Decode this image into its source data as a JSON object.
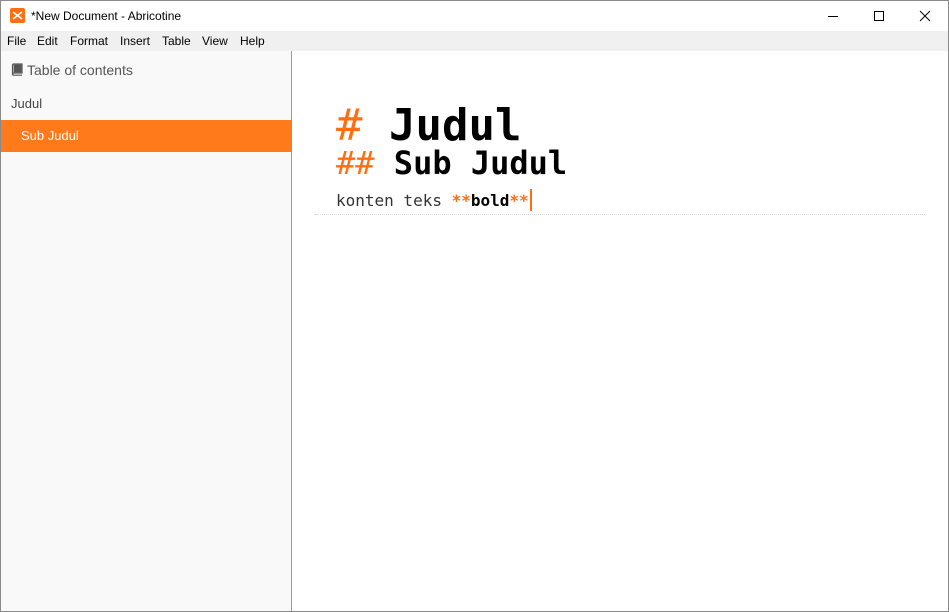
{
  "window": {
    "title": "*New Document - Abricotine",
    "icon": "abricotine-app-icon",
    "controls": [
      "minimize-icon",
      "maximize-icon",
      "close-icon"
    ]
  },
  "menu": {
    "items": [
      "File",
      "Edit",
      "Format",
      "Insert",
      "Table",
      "View",
      "Help"
    ]
  },
  "sidebar": {
    "header_icon": "book-icon",
    "header": "Table of contents",
    "items": [
      {
        "label": "Judul",
        "active": false
      },
      {
        "label": "Sub Judul",
        "active": true
      }
    ]
  },
  "editor": {
    "lines": {
      "h1_marker": "#",
      "h1_text": "Judul",
      "h2_marker": "##",
      "h2_text": "Sub Judul",
      "p_text": "konten teks ",
      "p_bold_open": "**",
      "p_bold_text": "bold",
      "p_bold_close": "**"
    }
  },
  "colors": {
    "accent": "#ff7a1a",
    "marker": "#ff6f11",
    "sidebar_bg": "#f9f9f9",
    "menubar_bg": "#f0f0f0"
  }
}
